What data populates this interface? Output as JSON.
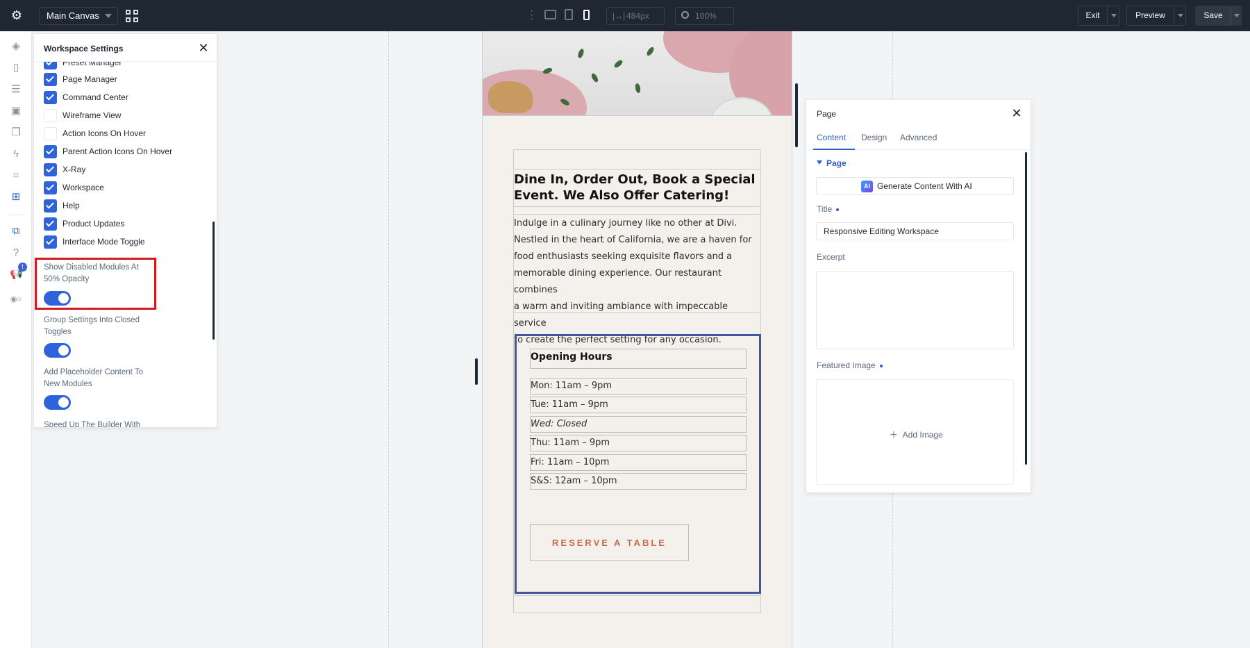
{
  "topbar": {
    "canvas_name": "Main Canvas",
    "width_value": "484px",
    "zoom_value": "100%",
    "exit_label": "Exit",
    "preview_label": "Preview",
    "save_label": "Save"
  },
  "workspace_settings": {
    "title": "Workspace Settings",
    "partial_top_item": "Preset Manager",
    "checkbox_items": [
      {
        "label": "Page Manager",
        "checked": true
      },
      {
        "label": "Command Center",
        "checked": true
      },
      {
        "label": "Wireframe View",
        "checked": false
      },
      {
        "label": "Action Icons On Hover",
        "checked": false
      },
      {
        "label": "Parent Action Icons On Hover",
        "checked": true
      },
      {
        "label": "X-Ray",
        "checked": true
      },
      {
        "label": "Workspace",
        "checked": true
      },
      {
        "label": "Help",
        "checked": true
      },
      {
        "label": "Product Updates",
        "checked": true
      },
      {
        "label": "Interface Mode Toggle",
        "checked": true
      }
    ],
    "toggles": [
      {
        "label": "Show Disabled Modules At 50% Opacity",
        "on": true
      },
      {
        "label": "Group Settings Into Closed Toggles",
        "on": true
      },
      {
        "label": "Add Placeholder Content To New Modules",
        "on": true
      }
    ],
    "partial_bottom_item": "Speed Up The Builder With"
  },
  "page_content": {
    "heading": "Dine In, Order Out, Book a Special Event. We Also Offer Catering!",
    "paragraph_lines": [
      "Indulge in a culinary journey like no other at Divi.",
      "Nestled in the heart of California, we are a haven for",
      "food enthusiasts seeking exquisite flavors and a",
      "memorable dining experience. Our restaurant combines",
      "a warm and inviting ambiance with impeccable service",
      "to create the perfect setting for any occasion."
    ],
    "hours_title": "Opening Hours",
    "hours": [
      {
        "text": "Mon: 11am – 9pm",
        "italic": false
      },
      {
        "text": "Tue: 11am – 9pm",
        "italic": false
      },
      {
        "text": "Wed: Closed",
        "italic": true
      },
      {
        "text": "Thu: 11am – 9pm",
        "italic": false
      },
      {
        "text": "Fri: 11am – 10pm",
        "italic": false
      },
      {
        "text": "S&S: 12am – 10pm",
        "italic": false
      }
    ],
    "reserve_label": "RESERVE A TABLE"
  },
  "page_settings": {
    "title": "Page",
    "tabs": [
      "Content",
      "Design",
      "Advanced"
    ],
    "section": "Page",
    "ai_button": "Generate Content With AI",
    "ai_badge": "AI",
    "title_label": "Title",
    "title_value": "Responsive Editing Workspace",
    "excerpt_label": "Excerpt",
    "featured_label": "Featured Image",
    "add_image": "Add Image"
  },
  "colors": {
    "accent": "#2f63d9",
    "highlight": "#d2191f",
    "topbar": "#1e2732",
    "reserve": "#c96a4b",
    "hours_border": "#4257a3"
  }
}
